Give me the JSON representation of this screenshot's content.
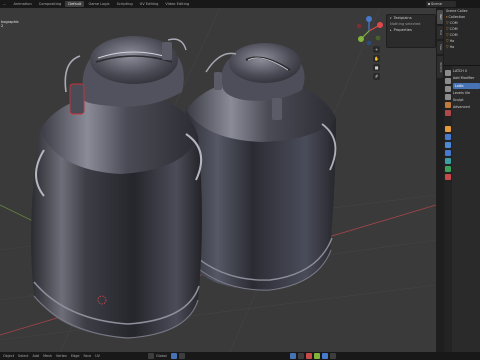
{
  "workspace_tabs": [
    {
      "label": "...",
      "active": false
    },
    {
      "label": "Animation",
      "active": false
    },
    {
      "label": "Compositing",
      "active": false
    },
    {
      "label": "Default",
      "active": true
    },
    {
      "label": "Game Logic",
      "active": false
    },
    {
      "label": "Scripting",
      "active": false
    },
    {
      "label": "UV Editing",
      "active": false
    },
    {
      "label": "Video Editing",
      "active": false
    }
  ],
  "scene_field": "Scene",
  "viewport": {
    "info_line1": "hographic",
    "info_line2": "2"
  },
  "npanel": {
    "header": "Textplains",
    "row2": "Nothing selected",
    "row3": "Properties"
  },
  "vtabs": [
    "Item",
    "Tool",
    "View",
    "3D-Print"
  ],
  "outliner": {
    "title": "Scene Collec",
    "items": [
      "Collection",
      "COM",
      "COM",
      "COM",
      "Ha",
      "Ha"
    ]
  },
  "properties": {
    "row1": "LATCH 0",
    "row2": "Add Modifier",
    "button": "Lattic",
    "row4": "Levels Vie",
    "row5": "Sculpt",
    "row6": "Advanced"
  },
  "statusbar": {
    "left": [
      "Object",
      "Select",
      "Add",
      "Mesh",
      "Vertex",
      "Edge",
      "Face",
      "UV"
    ],
    "mode": "Global"
  },
  "colors": {
    "accent": "#4772b3",
    "axis_x": "#e0484e",
    "axis_y": "#82b33a",
    "axis_z": "#4779cc",
    "selection_orange": "#e79a3c"
  }
}
